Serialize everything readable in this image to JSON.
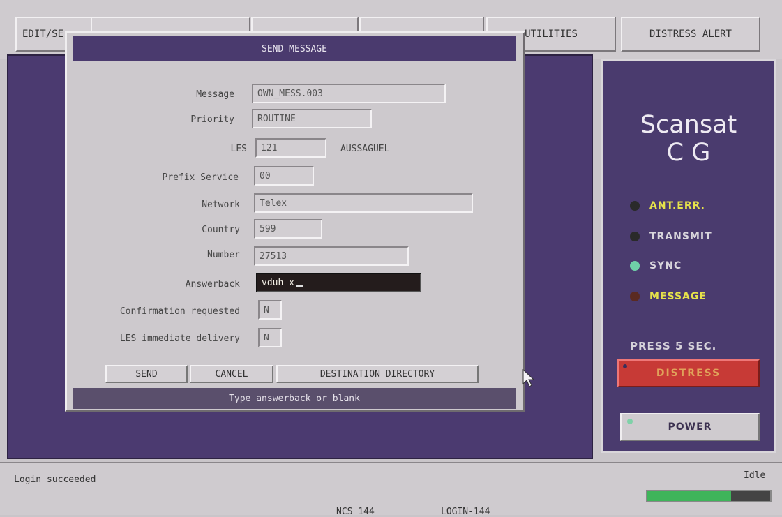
{
  "menu": {
    "edit_label": "EDIT/SE",
    "utilities_label": "UTILITIES",
    "distress_alert_label": "DISTRESS ALERT"
  },
  "panel": {
    "brand_line1": "Scansat",
    "brand_line2": "C G",
    "indicators": [
      {
        "label": "ANT.ERR.",
        "led_color": "#2a2a2a",
        "text_color": "#e6e34a"
      },
      {
        "label": "TRANSMIT",
        "led_color": "#2a2a2a",
        "text_color": "#d9d6dc"
      },
      {
        "label": "SYNC",
        "led_color": "#6fcfa8",
        "text_color": "#d9d6dc"
      },
      {
        "label": "MESSAGE",
        "led_color": "#5a2a22",
        "text_color": "#e6e34a"
      }
    ],
    "press_label": "PRESS 5 SEC.",
    "distress_button": "DISTRESS",
    "power_button": "POWER"
  },
  "dialog": {
    "title": "SEND  MESSAGE",
    "fields": {
      "message": {
        "label": "Message",
        "value": "OWN_MESS.003"
      },
      "priority": {
        "label": "Priority",
        "value": "ROUTINE"
      },
      "les": {
        "label": "LES",
        "value": "121",
        "extra": "AUSSAGUEL"
      },
      "prefix": {
        "label": "Prefix Service",
        "value": "00"
      },
      "network": {
        "label": "Network",
        "value": "Telex"
      },
      "country": {
        "label": "Country",
        "value": "599"
      },
      "number": {
        "label": "Number",
        "value": "27513"
      },
      "answerback": {
        "label": "Answerback",
        "value": "vduh x"
      },
      "confirmation": {
        "label": "Confirmation requested",
        "value": "N"
      },
      "immediate": {
        "label": "LES immediate delivery",
        "value": "N"
      }
    },
    "buttons": {
      "send": "SEND",
      "cancel": "CANCEL",
      "directory": "DESTINATION DIRECTORY"
    },
    "hint": "Type answerback or blank"
  },
  "status": {
    "message": "Login succeeded",
    "state": "Idle",
    "ncs": "NCS 144",
    "login": "LOGIN-144",
    "progress": 0.68,
    "progress_color": "#3fb45a"
  }
}
